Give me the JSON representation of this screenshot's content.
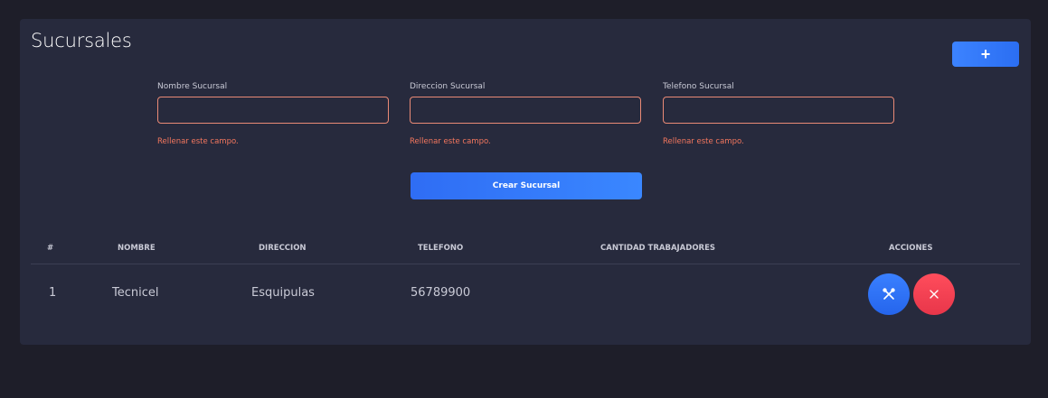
{
  "page": {
    "title": "Sucursales",
    "add_label": "+"
  },
  "form": {
    "fields": [
      {
        "label": "Nombre Sucursal",
        "value": "",
        "error": "Rellenar este campo."
      },
      {
        "label": "Direccion Sucursal",
        "value": "",
        "error": "Rellenar este campo."
      },
      {
        "label": "Telefono Sucursal",
        "value": "",
        "error": "Rellenar este campo."
      }
    ],
    "submit_label": "Crear Sucursal"
  },
  "table": {
    "headers": [
      "#",
      "NOMBRE",
      "DIRECCION",
      "TELEFONO",
      "CANTIDAD TRABAJADORES",
      "ACCIONES"
    ],
    "rows": [
      {
        "id": "1",
        "nombre": "Tecnicel",
        "direccion": "Esquipulas",
        "telefono": "56789900",
        "cantidad": ""
      }
    ],
    "edit_icon": "wrench-cross-icon",
    "delete_icon": "close-icon"
  },
  "colors": {
    "background": "#1e1e29",
    "card": "#272a3d",
    "primary": "#2f74f8",
    "danger": "#f0414f",
    "error": "#f4775e"
  }
}
